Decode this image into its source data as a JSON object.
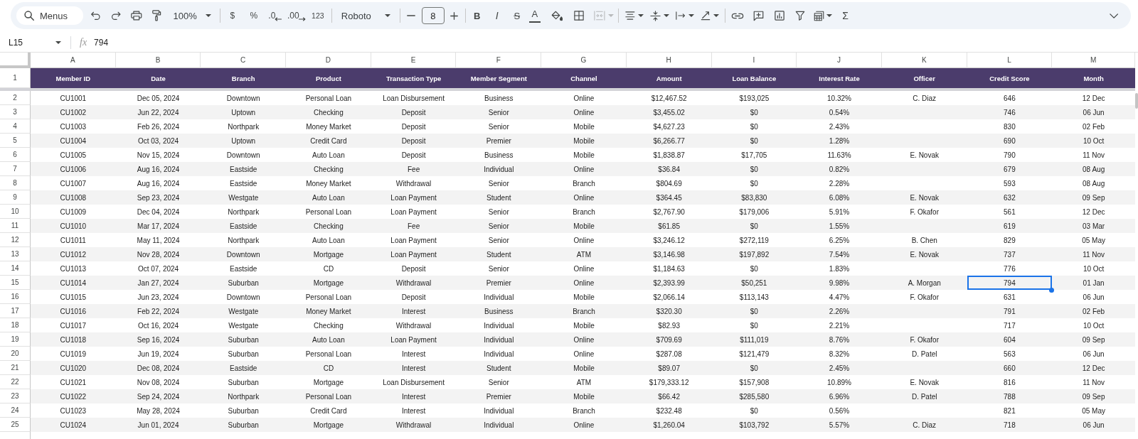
{
  "toolbar": {
    "search": {
      "placeholder": "Menus"
    },
    "zoom": "100%",
    "number_formats": [
      "$",
      "%",
      ".0",
      ".00",
      "123"
    ],
    "font": "Roboto",
    "font_size": "8",
    "text_styles": [
      "B",
      "I",
      "S",
      "A"
    ],
    "merge": {
      "disabled": true
    },
    "functions": "Σ"
  },
  "formula_bar": {
    "cell_ref": "L15",
    "fx": "fx",
    "value": "794"
  },
  "sheet": {
    "column_letters": [
      {
        "letter": "A",
        "selected": false
      },
      {
        "letter": "B",
        "selected": false
      },
      {
        "letter": "C",
        "selected": false
      },
      {
        "letter": "D",
        "selected": false
      },
      {
        "letter": "E",
        "selected": false
      },
      {
        "letter": "F",
        "selected": false
      },
      {
        "letter": "G",
        "selected": false
      },
      {
        "letter": "H",
        "selected": false
      },
      {
        "letter": "I",
        "selected": false
      },
      {
        "letter": "J",
        "selected": false
      },
      {
        "letter": "K",
        "selected": false
      },
      {
        "letter": "L",
        "selected": true
      },
      {
        "letter": "M",
        "selected": false
      }
    ],
    "header": {
      "row_number": "1",
      "cells": [
        "Member ID",
        "Date",
        "Branch",
        "Product",
        "Transaction Type",
        "Member Segment",
        "Channel",
        "Amount",
        "Loan Balance",
        "Interest Rate",
        "Officer",
        "Credit Score",
        "Month"
      ]
    },
    "rows": [
      {
        "row_number": "2",
        "selected": false,
        "member_id": "CU1001",
        "date": "Dec 05, 2024",
        "branch": "Downtown",
        "product": "Personal Loan",
        "transaction_type": "Loan Disbursement",
        "member_segment": "Business",
        "channel": "Online",
        "amount": "$12,467.52",
        "loan_balance": "$193,025",
        "interest_rate": "10.32%",
        "officer": "C. Diaz",
        "credit_score": "646",
        "month": "12 Dec"
      },
      {
        "row_number": "3",
        "selected": false,
        "member_id": "CU1002",
        "date": "Jun 22, 2024",
        "branch": "Uptown",
        "product": "Checking",
        "transaction_type": "Deposit",
        "member_segment": "Senior",
        "channel": "Online",
        "amount": "$3,455.02",
        "loan_balance": "$0",
        "interest_rate": "0.54%",
        "credit_score": "746",
        "month": "06 Jun"
      },
      {
        "row_number": "4",
        "selected": false,
        "member_id": "CU1003",
        "date": "Feb 26, 2024",
        "branch": "Northpark",
        "product": "Money Market",
        "transaction_type": "Deposit",
        "member_segment": "Senior",
        "channel": "Mobile",
        "amount": "$4,627.23",
        "loan_balance": "$0",
        "interest_rate": "2.43%",
        "credit_score": "830",
        "month": "02 Feb"
      },
      {
        "row_number": "5",
        "selected": false,
        "member_id": "CU1004",
        "date": "Oct 03, 2024",
        "branch": "Uptown",
        "product": "Credit Card",
        "transaction_type": "Deposit",
        "member_segment": "Premier",
        "channel": "Mobile",
        "amount": "$6,266.77",
        "loan_balance": "$0",
        "interest_rate": "1.28%",
        "credit_score": "690",
        "month": "10 Oct"
      },
      {
        "row_number": "6",
        "selected": false,
        "member_id": "CU1005",
        "date": "Nov 15, 2024",
        "branch": "Downtown",
        "product": "Auto Loan",
        "transaction_type": "Deposit",
        "member_segment": "Business",
        "channel": "Mobile",
        "amount": "$1,838.87",
        "loan_balance": "$17,705",
        "interest_rate": "11.63%",
        "officer": "E. Novak",
        "credit_score": "790",
        "month": "11 Nov"
      },
      {
        "row_number": "7",
        "selected": false,
        "member_id": "CU1006",
        "date": "Aug 16, 2024",
        "branch": "Eastside",
        "product": "Checking",
        "transaction_type": "Fee",
        "member_segment": "Individual",
        "channel": "Online",
        "amount": "$36.84",
        "loan_balance": "$0",
        "interest_rate": "0.82%",
        "credit_score": "679",
        "month": "08 Aug"
      },
      {
        "row_number": "8",
        "selected": false,
        "member_id": "CU1007",
        "date": "Aug 16, 2024",
        "branch": "Eastside",
        "product": "Money Market",
        "transaction_type": "Withdrawal",
        "member_segment": "Senior",
        "channel": "Branch",
        "amount": "$804.69",
        "loan_balance": "$0",
        "interest_rate": "2.28%",
        "credit_score": "593",
        "month": "08 Aug"
      },
      {
        "row_number": "9",
        "selected": false,
        "member_id": "CU1008",
        "date": "Sep 23, 2024",
        "branch": "Westgate",
        "product": "Auto Loan",
        "transaction_type": "Loan Payment",
        "member_segment": "Student",
        "channel": "Online",
        "amount": "$364.45",
        "loan_balance": "$83,830",
        "interest_rate": "6.08%",
        "officer": "E. Novak",
        "credit_score": "632",
        "month": "09 Sep"
      },
      {
        "row_number": "10",
        "selected": false,
        "member_id": "CU1009",
        "date": "Dec 04, 2024",
        "branch": "Northpark",
        "product": "Personal Loan",
        "transaction_type": "Loan Payment",
        "member_segment": "Senior",
        "channel": "Branch",
        "amount": "$2,767.90",
        "loan_balance": "$179,006",
        "interest_rate": "5.91%",
        "officer": "F. Okafor",
        "credit_score": "561",
        "month": "12 Dec"
      },
      {
        "row_number": "11",
        "selected": false,
        "member_id": "CU1010",
        "date": "Mar 17, 2024",
        "branch": "Eastside",
        "product": "Checking",
        "transaction_type": "Fee",
        "member_segment": "Senior",
        "channel": "Mobile",
        "amount": "$61.85",
        "loan_balance": "$0",
        "interest_rate": "1.55%",
        "credit_score": "619",
        "month": "03 Mar"
      },
      {
        "row_number": "12",
        "selected": false,
        "member_id": "CU1011",
        "date": "May 11, 2024",
        "branch": "Northpark",
        "product": "Auto Loan",
        "transaction_type": "Loan Payment",
        "member_segment": "Senior",
        "channel": "Online",
        "amount": "$3,246.12",
        "loan_balance": "$272,119",
        "interest_rate": "6.25%",
        "officer": "B. Chen",
        "credit_score": "829",
        "month": "05 May"
      },
      {
        "row_number": "13",
        "selected": false,
        "member_id": "CU1012",
        "date": "Nov 28, 2024",
        "branch": "Downtown",
        "product": "Mortgage",
        "transaction_type": "Loan Payment",
        "member_segment": "Student",
        "channel": "ATM",
        "amount": "$3,146.98",
        "loan_balance": "$197,892",
        "interest_rate": "7.54%",
        "officer": "E. Novak",
        "credit_score": "737",
        "month": "11 Nov"
      },
      {
        "row_number": "14",
        "selected": false,
        "member_id": "CU1013",
        "date": "Oct 07, 2024",
        "branch": "Eastside",
        "product": "CD",
        "transaction_type": "Deposit",
        "member_segment": "Senior",
        "channel": "Online",
        "amount": "$1,184.63",
        "loan_balance": "$0",
        "interest_rate": "1.83%",
        "credit_score": "776",
        "month": "10 Oct"
      },
      {
        "row_number": "15",
        "selected": true,
        "member_id": "CU1014",
        "date": "Jan 27, 2024",
        "branch": "Suburban",
        "product": "Mortgage",
        "transaction_type": "Withdrawal",
        "member_segment": "Premier",
        "channel": "Online",
        "amount": "$2,393.99",
        "loan_balance": "$50,251",
        "interest_rate": "9.98%",
        "officer": "A. Morgan",
        "credit_score": "794",
        "month": "01 Jan"
      },
      {
        "row_number": "16",
        "selected": false,
        "member_id": "CU1015",
        "date": "Jun 23, 2024",
        "branch": "Downtown",
        "product": "Personal Loan",
        "transaction_type": "Deposit",
        "member_segment": "Individual",
        "channel": "Mobile",
        "amount": "$2,066.14",
        "loan_balance": "$113,143",
        "interest_rate": "4.47%",
        "officer": "F. Okafor",
        "credit_score": "631",
        "month": "06 Jun"
      },
      {
        "row_number": "17",
        "selected": false,
        "member_id": "CU1016",
        "date": "Feb 22, 2024",
        "branch": "Westgate",
        "product": "Money Market",
        "transaction_type": "Interest",
        "member_segment": "Business",
        "channel": "Branch",
        "amount": "$320.30",
        "loan_balance": "$0",
        "interest_rate": "2.26%",
        "credit_score": "791",
        "month": "02 Feb"
      },
      {
        "row_number": "18",
        "selected": false,
        "member_id": "CU1017",
        "date": "Oct 16, 2024",
        "branch": "Westgate",
        "product": "Checking",
        "transaction_type": "Withdrawal",
        "member_segment": "Individual",
        "channel": "Mobile",
        "amount": "$82.93",
        "loan_balance": "$0",
        "interest_rate": "2.21%",
        "credit_score": "717",
        "month": "10 Oct"
      },
      {
        "row_number": "19",
        "selected": false,
        "member_id": "CU1018",
        "date": "Sep 16, 2024",
        "branch": "Suburban",
        "product": "Auto Loan",
        "transaction_type": "Loan Payment",
        "member_segment": "Individual",
        "channel": "Online",
        "amount": "$709.69",
        "loan_balance": "$111,019",
        "interest_rate": "8.76%",
        "officer": "F. Okafor",
        "credit_score": "604",
        "month": "09 Sep"
      },
      {
        "row_number": "20",
        "selected": false,
        "member_id": "CU1019",
        "date": "Jun 19, 2024",
        "branch": "Suburban",
        "product": "Personal Loan",
        "transaction_type": "Interest",
        "member_segment": "Individual",
        "channel": "Online",
        "amount": "$287.08",
        "loan_balance": "$121,479",
        "interest_rate": "8.32%",
        "officer": "D. Patel",
        "credit_score": "563",
        "month": "06 Jun"
      },
      {
        "row_number": "21",
        "selected": false,
        "member_id": "CU1020",
        "date": "Dec 08, 2024",
        "branch": "Eastside",
        "product": "CD",
        "transaction_type": "Interest",
        "member_segment": "Student",
        "channel": "Mobile",
        "amount": "$89.07",
        "loan_balance": "$0",
        "interest_rate": "2.45%",
        "credit_score": "660",
        "month": "12 Dec"
      },
      {
        "row_number": "22",
        "selected": false,
        "member_id": "CU1021",
        "date": "Nov 08, 2024",
        "branch": "Suburban",
        "product": "Mortgage",
        "transaction_type": "Loan Disbursement",
        "member_segment": "Senior",
        "channel": "ATM",
        "amount": "$179,333.12",
        "loan_balance": "$157,908",
        "interest_rate": "10.89%",
        "officer": "E. Novak",
        "credit_score": "816",
        "month": "11 Nov"
      },
      {
        "row_number": "23",
        "selected": false,
        "member_id": "CU1022",
        "date": "Sep 24, 2024",
        "branch": "Northpark",
        "product": "Personal Loan",
        "transaction_type": "Interest",
        "member_segment": "Premier",
        "channel": "Mobile",
        "amount": "$66.42",
        "loan_balance": "$285,580",
        "interest_rate": "6.96%",
        "officer": "D. Patel",
        "credit_score": "788",
        "month": "09 Sep"
      },
      {
        "row_number": "24",
        "selected": false,
        "member_id": "CU1023",
        "date": "May 28, 2024",
        "branch": "Suburban",
        "product": "Credit Card",
        "transaction_type": "Interest",
        "member_segment": "Individual",
        "channel": "Branch",
        "amount": "$232.48",
        "loan_balance": "$0",
        "interest_rate": "0.56%",
        "credit_score": "821",
        "month": "05 May"
      },
      {
        "row_number": "25",
        "selected": false,
        "member_id": "CU1024",
        "date": "Jun 01, 2024",
        "branch": "Suburban",
        "product": "Mortgage",
        "transaction_type": "Withdrawal",
        "member_segment": "Individual",
        "channel": "Online",
        "amount": "$1,260.04",
        "loan_balance": "$103,792",
        "interest_rate": "5.57%",
        "officer": "C. Diaz",
        "credit_score": "718",
        "month": "06 Jun"
      }
    ]
  }
}
